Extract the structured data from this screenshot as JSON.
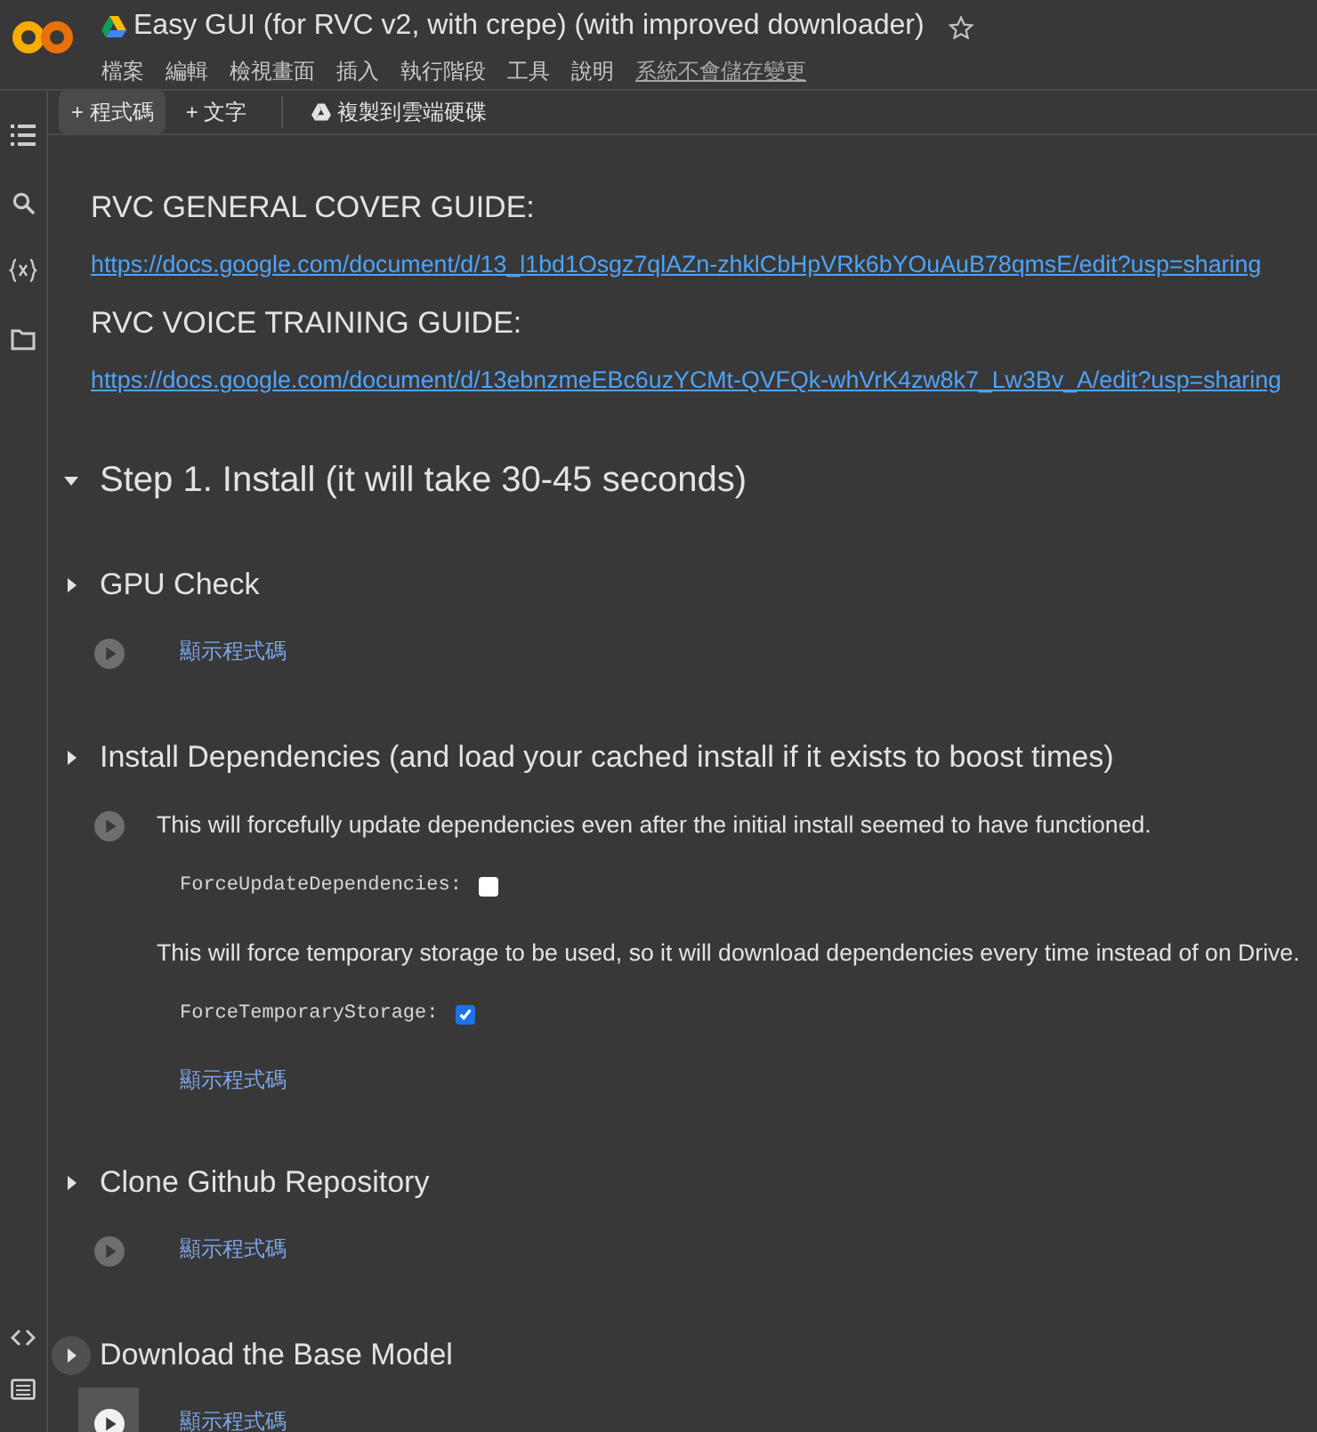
{
  "header": {
    "title": "Easy GUI (for RVC v2, with crepe) (with improved downloader)",
    "starred": false,
    "menu": [
      "檔案",
      "編輯",
      "檢視畫面",
      "插入",
      "執行階段",
      "工具",
      "說明"
    ],
    "save_notice": "系統不會儲存變更"
  },
  "toolbar": {
    "buttons": [
      {
        "label": "+ 程式碼",
        "selected": true
      },
      {
        "label": "+ 文字",
        "selected": false
      }
    ],
    "copy_to_drive": "複製到雲端硬碟"
  },
  "intro": [
    {
      "kind": "heading",
      "text": "RVC GENERAL COVER GUIDE:"
    },
    {
      "kind": "link",
      "text": "https://docs.google.com/document/d/13_l1bd1Osgz7qlAZn-zhklCbHpVRk6bYOuAuB78qmsE/edit?usp=sharing"
    },
    {
      "kind": "heading",
      "text": "RVC VOICE TRAINING GUIDE:"
    },
    {
      "kind": "link",
      "text": "https://docs.google.com/document/d/13ebnzmeEBc6uzYCMt-QVFQk-whVrK4zw8k7_Lw3Bv_A/edit?usp=sharing"
    }
  ],
  "section": {
    "title": "Step 1. Install (it will take 30-45 seconds)",
    "expanded": true,
    "children": [
      {
        "title": "GPU Check",
        "expanded": false,
        "hovered": false,
        "cells": [
          {
            "kind": "show_code",
            "text": "顯示程式碼"
          }
        ]
      },
      {
        "title": "Install Dependencies (and load your cached install if it exists to boost times)",
        "expanded": false,
        "hovered": false,
        "cells": [
          {
            "kind": "text",
            "text": "This will forcefully update dependencies even after the initial install seemed to have functioned."
          },
          {
            "kind": "checkbox",
            "label": "ForceUpdateDependencies:",
            "checked": false
          },
          {
            "kind": "text",
            "text": "This will force temporary storage to be used, so it will download dependencies every time instead of on Drive."
          },
          {
            "kind": "checkbox",
            "label": "ForceTemporaryStorage:",
            "checked": true
          },
          {
            "kind": "show_code",
            "text": "顯示程式碼"
          }
        ]
      },
      {
        "title": "Clone Github Repository",
        "expanded": false,
        "hovered": false,
        "cells": [
          {
            "kind": "show_code",
            "text": "顯示程式碼"
          }
        ]
      },
      {
        "title": "Download the Base Model",
        "expanded": false,
        "hovered": true,
        "cells": [
          {
            "kind": "show_code",
            "text": "顯示程式碼"
          }
        ]
      }
    ]
  }
}
